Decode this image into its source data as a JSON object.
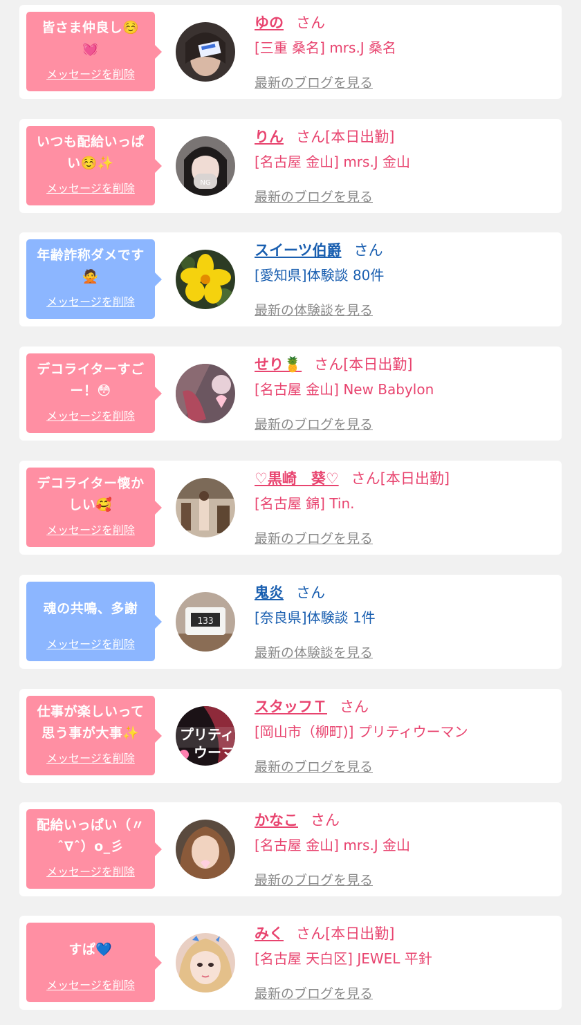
{
  "delete_label": "メッセージを削除",
  "colors": {
    "pink_bubble": "#ff8fa3",
    "blue_bubble": "#8cb6ff",
    "pink_text": "#e8446f",
    "blue_text": "#1a5fb0",
    "link_gray": "#8a8a8a"
  },
  "items": [
    {
      "message": "皆さま仲良し☺️💓",
      "bubble": "pink",
      "name": "ゆの",
      "suffix": "さん",
      "shop": "[三重 桑名] mrs.J 桑名",
      "link": "最新のブログを見る",
      "avatar_icon": "avatar-photo"
    },
    {
      "message": "いつも配給いっぱい☺️✨",
      "bubble": "pink",
      "name": "りん",
      "suffix": "さん[本日出勤]",
      "shop": "[名古屋 金山] mrs.J 金山",
      "link": "最新のブログを見る",
      "avatar_icon": "avatar-photo"
    },
    {
      "message": "年齢詐称ダメです🙅",
      "bubble": "blue",
      "name": "スイーツ伯爵",
      "suffix": "さん",
      "shop": "[愛知県]体験談 80件",
      "link": "最新の体験談を見る",
      "avatar_icon": "avatar-photo"
    },
    {
      "message": "デコライターすごー！😳",
      "bubble": "pink",
      "name": "せり🍍",
      "suffix": "さん[本日出勤]",
      "shop": "[名古屋 金山] New Babylon",
      "link": "最新のブログを見る",
      "avatar_icon": "avatar-photo"
    },
    {
      "message": "デコライター懐かしい🥰",
      "bubble": "pink",
      "name": "♡黒崎　葵♡",
      "suffix": "さん[本日出勤]",
      "shop": "[名古屋 錦] Tin.",
      "link": "最新のブログを見る",
      "avatar_icon": "avatar-photo"
    },
    {
      "message": "魂の共鳴、多謝",
      "bubble": "blue",
      "name": "鬼炎",
      "suffix": "さん",
      "shop": "[奈良県]体験談 1件",
      "link": "最新の体験談を見る",
      "avatar_icon": "avatar-photo"
    },
    {
      "message": "仕事が楽しいって思う事が大事✨",
      "bubble": "pink",
      "name": "スタッフＴ",
      "suffix": "さん",
      "shop": "[岡山市（柳町)] プリティウーマン",
      "link": "最新のブログを見る",
      "avatar_icon": "avatar-photo"
    },
    {
      "message": "配給いっぱい（〃ˆ∇ˆ）o_彡",
      "bubble": "pink",
      "name": "かなこ",
      "suffix": "さん",
      "shop": "[名古屋 金山] mrs.J 金山",
      "link": "最新のブログを見る",
      "avatar_icon": "avatar-photo"
    },
    {
      "message": "すぱ💙",
      "bubble": "pink",
      "name": "みく",
      "suffix": "さん[本日出勤]",
      "shop": "[名古屋 天白区] JEWEL 平針",
      "link": "最新のブログを見る",
      "avatar_icon": "avatar-photo"
    }
  ]
}
